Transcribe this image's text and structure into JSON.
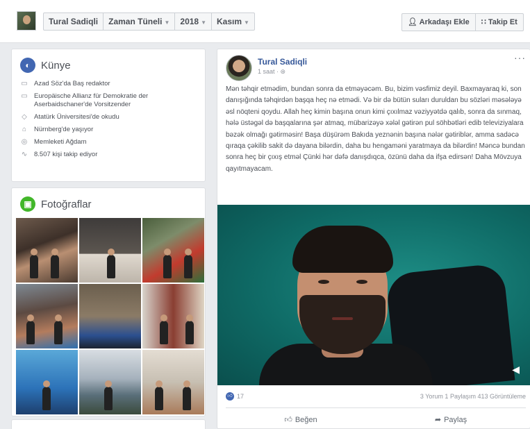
{
  "topbar": {
    "profile_name": "Tural Sadiqli",
    "timeline": "Zaman Tüneli",
    "year": "2018",
    "month": "Kasım",
    "add_friend": "Arkadaşı Ekle",
    "follow": "Takip Et"
  },
  "intro": {
    "title": "Künye",
    "items": [
      {
        "icon": "briefcase-icon",
        "text": "Azad Söz'da Baş redaktor"
      },
      {
        "icon": "briefcase-icon",
        "text": "Europäische Allianz für Demokratie der Aserbaidschaner'de Vorsitzender"
      },
      {
        "icon": "graduation-cap-icon",
        "text": "Atatürk Üniversitesi'de okudu"
      },
      {
        "icon": "home-icon",
        "text": "Nürnberg'de yaşıyor"
      },
      {
        "icon": "location-pin-icon",
        "text": "Memleketi Ağdam"
      },
      {
        "icon": "rss-icon",
        "text": "8.507 kişi takip ediyor"
      }
    ]
  },
  "photos": {
    "title": "Fotoğraflar"
  },
  "post": {
    "author": "Tural Sadiqli",
    "time": "1 saat",
    "more": "···",
    "text": "Mən təhqir etmədim, bundan sonra da etməyəcəm. Bu, bizim vəsfimiz deyil. Baxmayaraq ki, son danışığında təhqirdən başqa heç nə etmədi. Və bir də bütün suları duruldan bu sözləri məsələyə əsl nöqteni qoydu. Allah heç kimin başına onun kimi çıxılmaz vəziyyətdə qalıb, sonra da sınmaq, hələ üstəgəl də başqalarına şər atmaq, mübarizəyə xələl gətirən pul söhbətləri edib televiziyalara bəzək olmağı gətirməsin! Başa düşürəm Bakıda yeznənin başına nələr gətiriblər, amma sadəcə qıraqa çəkilib sakit də dayana bilərdin, daha bu hengaməni yaratmaya da bilərdin! Məncə bundan sonra heç bir çıxış etməl Çünki hər dəfə danışdıqca, özünü daha da ifşa edirsən! Daha Mövzuya qayıtmayacam.",
    "like_count": "17",
    "stats": "3 Yorum 1 Paylaşım 413 Görüntüleme",
    "like_label": "Beğen",
    "share_label": "Paylaş"
  }
}
